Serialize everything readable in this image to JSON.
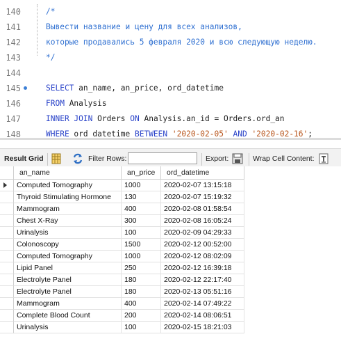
{
  "editor": {
    "lines": [
      {
        "num": "140",
        "segments": [
          {
            "t": "/*",
            "c": "cm"
          }
        ]
      },
      {
        "num": "141",
        "segments": [
          {
            "t": "Вывести название и цену для всех анализов,",
            "c": "cm"
          }
        ]
      },
      {
        "num": "142",
        "segments": [
          {
            "t": "которые продавались 5 февраля 2020 и всю следующую неделю.",
            "c": "cm"
          }
        ]
      },
      {
        "num": "143",
        "segments": [
          {
            "t": "*/",
            "c": "cm"
          }
        ]
      },
      {
        "num": "144",
        "segments": []
      },
      {
        "num": "145",
        "marker": true,
        "segments": [
          {
            "t": "SELECT",
            "c": "kw"
          },
          {
            "t": " an_name, an_price, ord_datetime",
            "c": "id"
          }
        ]
      },
      {
        "num": "146",
        "segments": [
          {
            "t": "FROM",
            "c": "kw"
          },
          {
            "t": " Analysis",
            "c": "id"
          }
        ]
      },
      {
        "num": "147",
        "segments": [
          {
            "t": "INNER JOIN",
            "c": "kw"
          },
          {
            "t": " Orders ",
            "c": "id"
          },
          {
            "t": "ON",
            "c": "kw"
          },
          {
            "t": " Analysis.an_id = Orders.ord_an",
            "c": "id"
          }
        ]
      },
      {
        "num": "148",
        "segments": [
          {
            "t": "WHERE",
            "c": "kw"
          },
          {
            "t": " ord_datetime ",
            "c": "id"
          },
          {
            "t": "BETWEEN",
            "c": "kw"
          },
          {
            "t": " ",
            "c": "id"
          },
          {
            "t": "'2020-02-05'",
            "c": "str"
          },
          {
            "t": " ",
            "c": "id"
          },
          {
            "t": "AND",
            "c": "kw"
          },
          {
            "t": " ",
            "c": "id"
          },
          {
            "t": "'2020-02-16'",
            "c": "str"
          },
          {
            "t": ";",
            "c": "id"
          }
        ]
      }
    ]
  },
  "toolbar": {
    "result_grid_label": "Result Grid",
    "filter_rows_label": "Filter Rows:",
    "filter_value": "",
    "export_label": "Export:",
    "wrap_label": "Wrap Cell Content:"
  },
  "grid": {
    "columns": [
      "an_name",
      "an_price",
      "ord_datetime"
    ],
    "rows": [
      [
        "Computed Tomography",
        "1000",
        "2020-02-07 13:15:18"
      ],
      [
        "Thyroid Stimulating Hormone",
        "130",
        "2020-02-07 15:19:32"
      ],
      [
        "Mammogram",
        "400",
        "2020-02-08 01:58:54"
      ],
      [
        "Chest X-Ray",
        "300",
        "2020-02-08 16:05:24"
      ],
      [
        "Urinalysis",
        "100",
        "2020-02-09 04:29:33"
      ],
      [
        "Colonoscopy",
        "1500",
        "2020-02-12 00:52:00"
      ],
      [
        "Computed Tomography",
        "1000",
        "2020-02-12 08:02:09"
      ],
      [
        "Lipid Panel",
        "250",
        "2020-02-12 16:39:18"
      ],
      [
        "Electrolyte Panel",
        "180",
        "2020-02-12 22:17:40"
      ],
      [
        "Electrolyte Panel",
        "180",
        "2020-02-13 05:51:16"
      ],
      [
        "Mammogram",
        "400",
        "2020-02-14 07:49:22"
      ],
      [
        "Complete Blood Count",
        "200",
        "2020-02-14 08:06:51"
      ],
      [
        "Urinalysis",
        "100",
        "2020-02-15 18:21:03"
      ]
    ],
    "current_row": 0
  }
}
